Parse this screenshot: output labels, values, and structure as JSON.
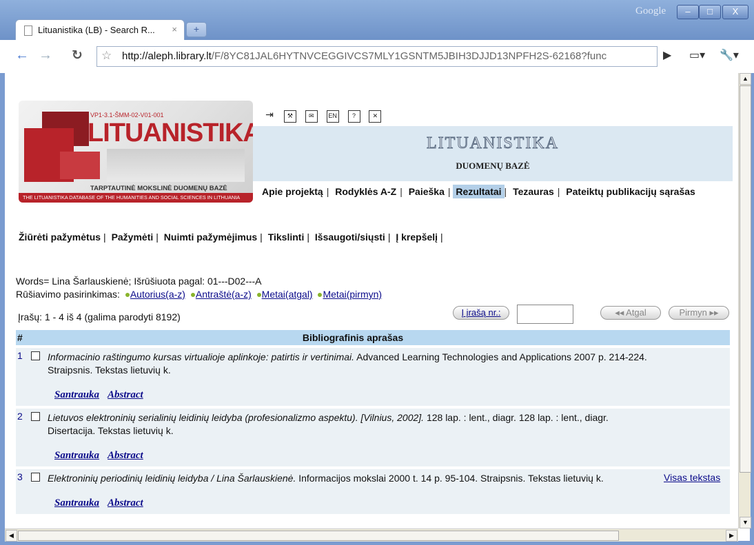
{
  "browser": {
    "brand": "Google",
    "tab_title": "Lituanistika (LB) - Search R...",
    "tab_close": "×",
    "new_tab": "+",
    "url_host": "http://aleph.library.lt",
    "url_path": "/F/8YC81JAL6HYTNVCEGGIVCS7MLY1GSNTM5JBIH3DJJD13NPFH2S-62168?func",
    "controls": {
      "minimize": "–",
      "maximize": "□",
      "close": "X"
    }
  },
  "banner": {
    "code": "VP1-3.1-ŠMM-02-V01-001",
    "logo": "LITUANISTIKA",
    "subtitle": "TARPTAUTINĖ MOKSLINĖ DUOMENŲ BAZĖ",
    "strip": "THE LITUANISTIKA DATABASE OF THE HUMANITIES AND SOCIAL SCIENCES IN LITHUANIA"
  },
  "title_band": {
    "title": "LITUANISTIKA",
    "subtitle": "DUOMENŲ BAZĖ"
  },
  "main_nav": [
    {
      "label": "Apie projektą",
      "active": false
    },
    {
      "label": "Rodyklės A-Z",
      "active": false
    },
    {
      "label": "Paieška",
      "active": false
    },
    {
      "label": "Rezultatai",
      "active": true
    },
    {
      "label": "Tezauras",
      "active": false
    },
    {
      "label": "Pateiktų publikacijų sąrašas",
      "active": false
    }
  ],
  "actions": [
    "Žiūrėti pažymėtus",
    "Pažymėti",
    "Nuimti pažymėjimus",
    "Tikslinti",
    "Išsaugoti/siųsti",
    "Į krepšelį"
  ],
  "query": {
    "words": "Words= Lina Šarlauskienė; Išrūšiuota pagal: 01---D02---A",
    "sort_label": "Rūšiavimo pasirinkimas:",
    "sort_options": [
      "Autorius(a-z)",
      "Antraštė(a-z)",
      "Metai(atgal)",
      "Metai(pirmyn)"
    ],
    "counter": "Įrašų: 1 - 4 iš 4 (galima parodyti 8192)"
  },
  "paging": {
    "goto_label": "Į įrašą nr.:",
    "goto_value": "",
    "prev_label": "◂◂ Atgal",
    "next_label": "Pirmyn ▸▸"
  },
  "table": {
    "col_num": "#",
    "col_desc": "Bibliografinis aprašas",
    "rows": [
      {
        "num": "1",
        "title": "Informacinio raštingumo kursas virtualioje aplinkoje: patirtis ir vertinimai.",
        "rest": " Advanced Learning Technologies and Applications 2007 p. 214-224. Straipsnis. Tekstas lietuvių  k.",
        "link1": "Santrauka",
        "link2": "Abstract",
        "full": ""
      },
      {
        "num": "2",
        "title": "Lietuvos elektroninių serialinių leidinių leidyba (profesionalizmo aspektu). [Vilnius, 2002].",
        "rest": " 128 lap. : lent., diagr. 128 lap. : lent., diagr. Disertacija. Tekstas lietuvių  k.",
        "link1": "Santrauka",
        "link2": "Abstract",
        "full": ""
      },
      {
        "num": "3",
        "title": "Elektroninių periodinių leidinių leidyba / Lina Šarlauskienė.",
        "rest": " Informacijos mokslai 2000 t. 14 p. 95-104. Straipsnis. Tekstas lietuvių  k.",
        "link1": "Santrauka",
        "link2": "Abstract",
        "full": "Visas tekstas"
      }
    ]
  }
}
